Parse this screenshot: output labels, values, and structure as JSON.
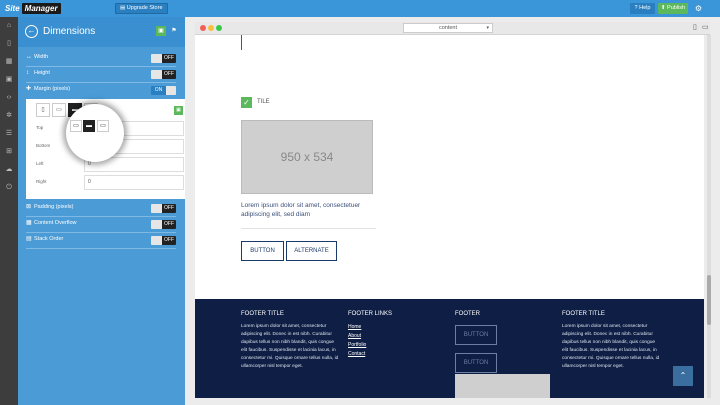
{
  "topbar": {
    "brand_site": "Site",
    "brand_manager": "Manager",
    "upgrade_label": "Upgrade Store",
    "help_label": "Help",
    "publish_label": "Publish"
  },
  "sidebar_icons": [
    "home-icon",
    "file-icon",
    "grid-icon",
    "image-icon",
    "code-icon",
    "cogs-icon",
    "layers-icon",
    "cart-icon",
    "cloud-icon",
    "power-icon"
  ],
  "panel": {
    "title": "Dimensions",
    "rows": [
      {
        "label": "Width",
        "state": "OFF"
      },
      {
        "label": "Height",
        "state": "OFF"
      },
      {
        "label": "Margin (pixels)",
        "state": "ON"
      },
      {
        "label": "Padding (pixels)",
        "state": "OFF"
      },
      {
        "label": "Content Overflow",
        "state": "OFF"
      },
      {
        "label": "Stack Order",
        "state": "OFF"
      }
    ],
    "margin_fields": [
      {
        "label": "Top",
        "value": "0"
      },
      {
        "label": "Bottom",
        "value": "0"
      },
      {
        "label": "Left",
        "value": "0"
      },
      {
        "label": "Right",
        "value": "0"
      }
    ]
  },
  "browser": {
    "url_value": "content"
  },
  "page": {
    "tile_label": "TILE",
    "placeholder_text": "950 x 534",
    "lorem": "Lorem ipsum dolor sit amet, consectetuer adipiscing elit, sed diam",
    "button_label": "BUTTON",
    "alternate_label": "ALTERNATE"
  },
  "footer": {
    "col1_title": "FOOTER TITLE",
    "col1_text": "Lorem ipsum dolor sit amet, consectetur adipiscing elit. Donec in est nibh. Curabitur dapibus tellus non nibh blandit, quis congue elit faucibus. Suspendisse et lacinia lacus, in consectetur mi. Quisque ornare tellus nulla, id ullamcorper nisl tempor eget.",
    "col2_title": "FOOTER LINKS",
    "links": [
      "Home",
      "About",
      "Portfolio",
      "Contact"
    ],
    "col3_title": "FOOTER",
    "col3_button1": "BUTTON",
    "col3_button2": "BUTTON",
    "col4_title": "FOOTER TITLE",
    "col4_text": "Lorem ipsum dolor sit amet, consectetur adipiscing elit. Donec in est nibh. Curabitur dapibus tellus non nibh blandit, quis congue elit faucibus. Suspendisse et lacinia lacus, in consectetur mi. Quisque ornare tellus nulla, id ullamcorper nisl tempor eget."
  }
}
